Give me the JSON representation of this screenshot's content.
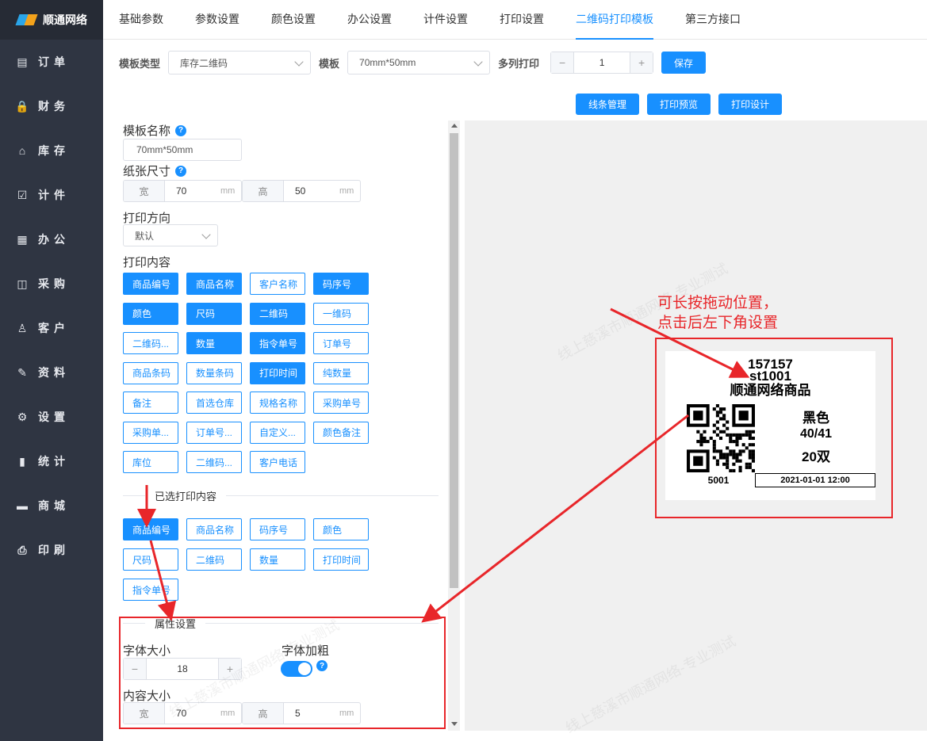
{
  "brand": {
    "name": "顺通网络"
  },
  "sidebar": {
    "items": [
      {
        "label": "订单",
        "icon": "order-icon",
        "glyph": "▤"
      },
      {
        "label": "财务",
        "icon": "lock-icon",
        "glyph": "🔒"
      },
      {
        "label": "库存",
        "icon": "home-icon",
        "glyph": "⌂"
      },
      {
        "label": "计件",
        "icon": "clipboard-icon",
        "glyph": "☑"
      },
      {
        "label": "办公",
        "icon": "calendar-icon",
        "glyph": "▦"
      },
      {
        "label": "采购",
        "icon": "bag-icon",
        "glyph": "◫"
      },
      {
        "label": "客户",
        "icon": "user-icon",
        "glyph": "♙"
      },
      {
        "label": "资料",
        "icon": "edit-icon",
        "glyph": "✎"
      },
      {
        "label": "设置",
        "icon": "gear-icon",
        "glyph": "⚙"
      },
      {
        "label": "统计",
        "icon": "bar-chart-icon",
        "glyph": "▮"
      },
      {
        "label": "商城",
        "icon": "store-icon",
        "glyph": "▬"
      },
      {
        "label": "印刷",
        "icon": "printer-icon",
        "glyph": "⎙"
      }
    ]
  },
  "tabs": [
    "基础参数",
    "参数设置",
    "颜色设置",
    "办公设置",
    "计件设置",
    "打印设置",
    "二维码打印模板",
    "第三方接口"
  ],
  "active_tab": "二维码打印模板",
  "toolbar": {
    "template_type_label": "模板类型",
    "template_type_value": "库存二维码",
    "template_label": "模板",
    "template_value": "70mm*50mm",
    "multi_print_label": "多列打印",
    "multi_print_value": "1",
    "minus": "−",
    "plus": "+",
    "save": "保存"
  },
  "actions": {
    "line_manage": "线条管理",
    "print_preview": "打印预览",
    "print_design": "打印设计"
  },
  "form": {
    "template_name_label": "模板名称",
    "template_name_value": "70mm*50mm",
    "paper_size_label": "纸张尺寸",
    "width_prefix": "宽",
    "width_value": "70",
    "height_prefix": "高",
    "height_value": "50",
    "unit": "mm",
    "orientation_label": "打印方向",
    "orientation_value": "默认",
    "content_label": "打印内容",
    "selected_label": "已选打印内容",
    "attr_label": "属性设置",
    "font_size_label": "字体大小",
    "font_size_value": "18",
    "bold_label": "字体加粗",
    "content_size_label": "内容大小",
    "content_width_value": "70",
    "content_height_value": "5",
    "help": "?"
  },
  "print_content": [
    {
      "label": "商品编号",
      "on": true
    },
    {
      "label": "商品名称",
      "on": true
    },
    {
      "label": "客户名称",
      "on": false
    },
    {
      "label": "码序号",
      "on": true
    },
    {
      "label": "颜色",
      "on": true
    },
    {
      "label": "尺码",
      "on": true
    },
    {
      "label": "二维码",
      "on": true
    },
    {
      "label": "一维码",
      "on": false
    },
    {
      "label": "二维码...",
      "on": false
    },
    {
      "label": "数量",
      "on": true
    },
    {
      "label": "指令单号",
      "on": true
    },
    {
      "label": "订单号",
      "on": false
    },
    {
      "label": "商品条码",
      "on": false
    },
    {
      "label": "数量条码",
      "on": false
    },
    {
      "label": "打印时间",
      "on": true
    },
    {
      "label": "纯数量",
      "on": false
    },
    {
      "label": "备注",
      "on": false
    },
    {
      "label": "首选仓库",
      "on": false
    },
    {
      "label": "规格名称",
      "on": false
    },
    {
      "label": "采购单号",
      "on": false
    },
    {
      "label": "采购单...",
      "on": false
    },
    {
      "label": "订单号...",
      "on": false
    },
    {
      "label": "自定义...",
      "on": false
    },
    {
      "label": "颜色备注",
      "on": false
    },
    {
      "label": "库位",
      "on": false
    },
    {
      "label": "二维码...",
      "on": false
    },
    {
      "label": "客户电话",
      "on": false
    }
  ],
  "selected_content": [
    {
      "label": "商品编号",
      "on": true
    },
    {
      "label": "商品名称",
      "on": false
    },
    {
      "label": "码序号",
      "on": false
    },
    {
      "label": "颜色",
      "on": false
    },
    {
      "label": "尺码",
      "on": false
    },
    {
      "label": "二维码",
      "on": false
    },
    {
      "label": "数量",
      "on": false
    },
    {
      "label": "打印时间",
      "on": false
    },
    {
      "label": "指令单号",
      "on": false
    }
  ],
  "label_preview": {
    "line1": "157157",
    "line2": "st1001",
    "line3": "顺通网络商品",
    "color": "黑色",
    "size": "40/41",
    "qty": "20双",
    "order": "5001",
    "time": "2021-01-01 12:00"
  },
  "annotation": {
    "line1": "可长按拖动位置，",
    "line2": "点击后左下角设置"
  },
  "watermark": "线上慈溪市顺通网络-专业测试",
  "colors": {
    "primary": "#1890ff",
    "sidebar": "#2f3542",
    "annotation": "#e8262a"
  }
}
